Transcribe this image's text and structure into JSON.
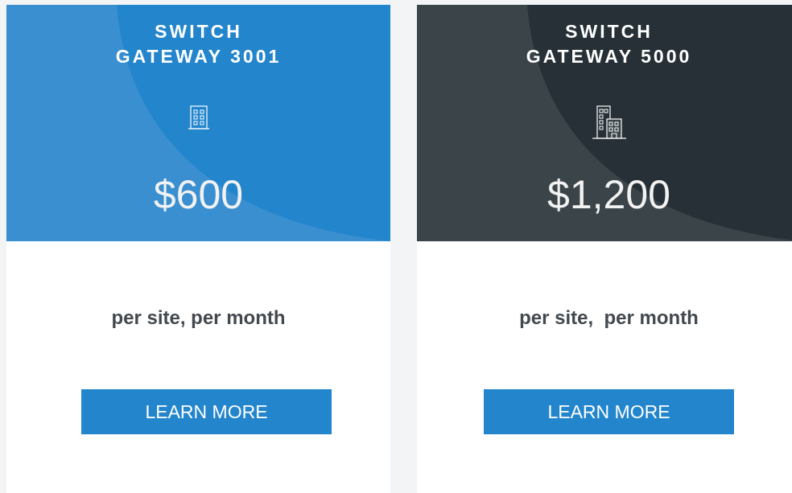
{
  "plans": [
    {
      "title_line1": "SWITCH",
      "title_line2": "GATEWAY 3001",
      "icon": "building-icon",
      "price": "$600",
      "period": "per site, per month",
      "button_label": "LEARN MORE"
    },
    {
      "title_line1": "SWITCH",
      "title_line2": "GATEWAY 5000",
      "icon": "buildings-icon",
      "price": "$1,200",
      "period": "per site,  per month",
      "button_label": "LEARN MORE"
    }
  ],
  "colors": {
    "page_background": "#f3f4f5",
    "card_background": "#ffffff",
    "blue_header": "#3a8fd0",
    "blue_header_curve": "#2385cc",
    "dark_header": "#3a4449",
    "dark_header_curve": "#263036",
    "button": "#2385cc",
    "period_text": "#43494e"
  }
}
